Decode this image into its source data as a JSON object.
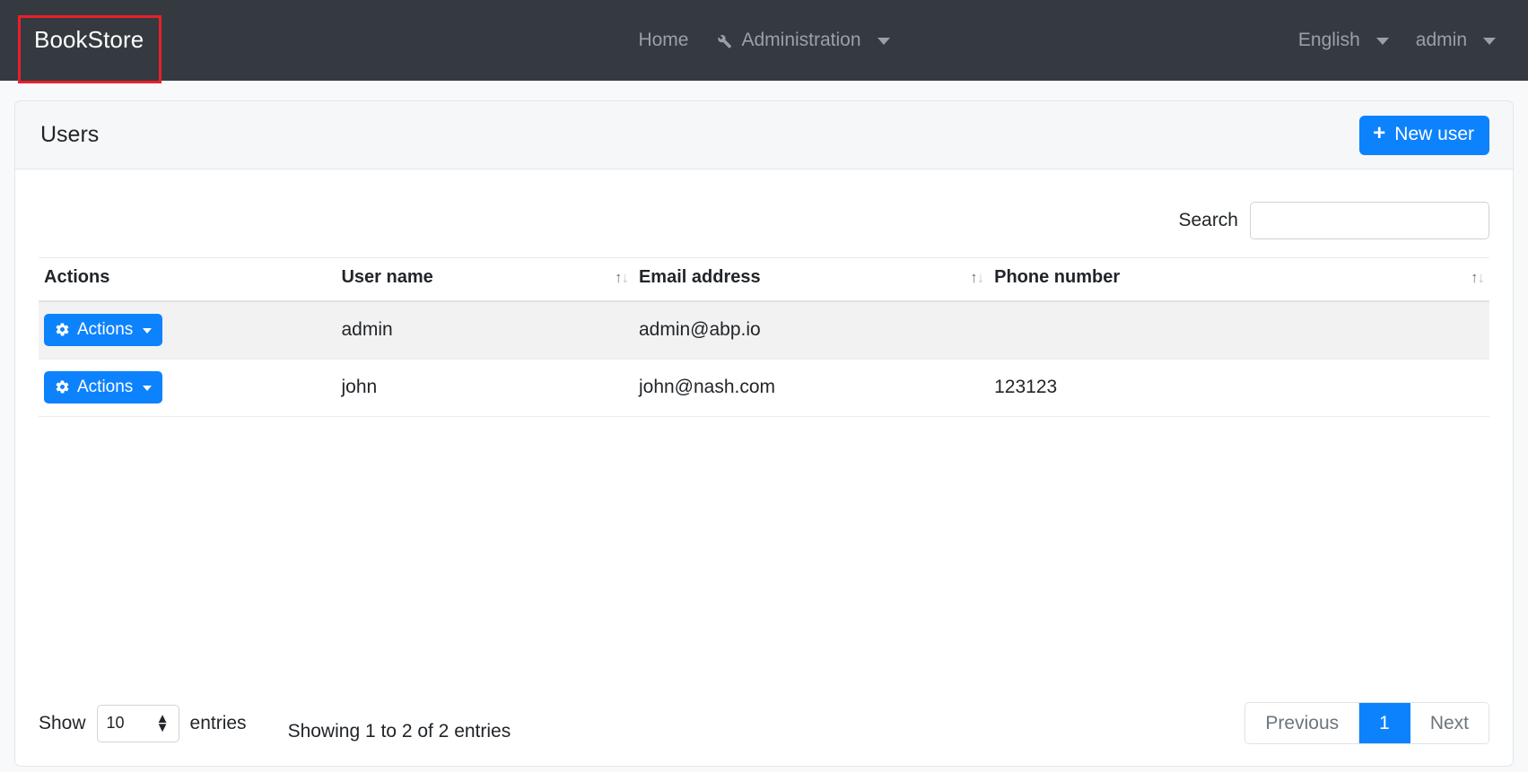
{
  "navbar": {
    "brand": "BookStore",
    "brand_highlight_color": "#e8202a",
    "links": [
      {
        "label": "Home",
        "icon": ""
      },
      {
        "label": "Administration",
        "icon": "wrench-icon"
      }
    ],
    "language": "English",
    "user": "admin"
  },
  "card": {
    "title": "Users",
    "new_button_label": "New user",
    "new_button_icon": "plus-icon",
    "accent_color": "#0d82fd"
  },
  "search": {
    "label": "Search",
    "value": "",
    "placeholder": ""
  },
  "table": {
    "columns": [
      {
        "label": "Actions",
        "sortable": false
      },
      {
        "label": "User name",
        "sortable": true
      },
      {
        "label": "Email address",
        "sortable": true
      },
      {
        "label": "Phone number",
        "sortable": true
      }
    ],
    "sort_icon": "sort-updown-icon",
    "row_action_label": "Actions",
    "row_action_icon": "gear-icon",
    "rows": [
      {
        "user_name": "admin",
        "email": "admin@abp.io",
        "phone": ""
      },
      {
        "user_name": "john",
        "email": "john@nash.com",
        "phone": "123123"
      }
    ]
  },
  "footer": {
    "show_label": "Show",
    "entries_label": "entries",
    "page_length": "10",
    "info": "Showing 1 to 2 of 2 entries",
    "pagination": {
      "previous": "Previous",
      "pages": [
        "1"
      ],
      "next": "Next",
      "active": "1"
    }
  }
}
